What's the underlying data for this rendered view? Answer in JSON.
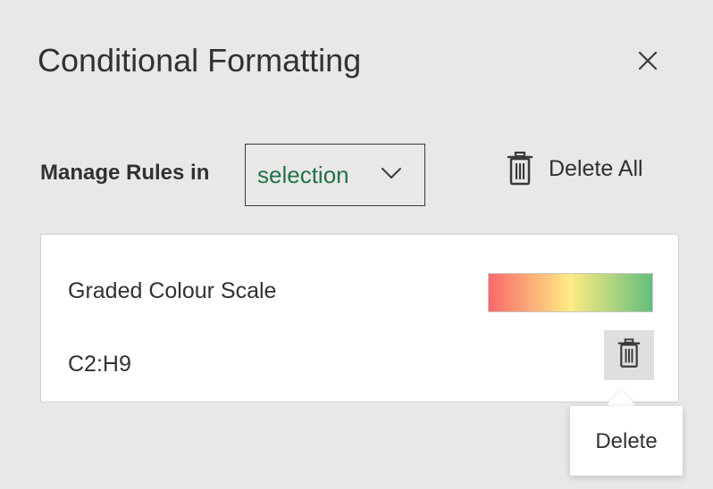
{
  "panel": {
    "title": "Conditional Formatting",
    "close_icon": "close-icon"
  },
  "manage": {
    "label": "Manage Rules in",
    "scope_value": "selection",
    "scope_icon": "chevron-down-icon",
    "delete_all_label": "Delete All",
    "delete_all_icon": "trash-icon"
  },
  "rule": {
    "name": "Graded Colour Scale",
    "range": "C2:H9",
    "scale_colors": [
      "#f8696b",
      "#ffeb84",
      "#63be7b"
    ],
    "delete_icon": "trash-icon"
  },
  "tooltip": {
    "text": "Delete"
  },
  "colors": {
    "accent_green": "#217346",
    "panel_bg": "#eae8e6"
  }
}
